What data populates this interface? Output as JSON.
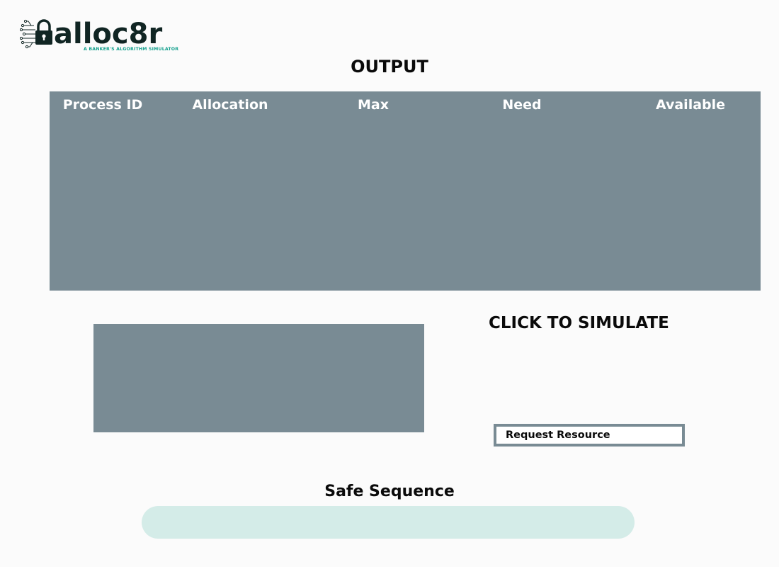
{
  "app": {
    "logo_text": "alloc8r",
    "tagline": "A BANKER'S ALGORITHM SIMULATOR"
  },
  "output": {
    "title": "OUTPUT",
    "columns": [
      "Process ID",
      "Allocation",
      "Max",
      "Need",
      "Available"
    ]
  },
  "simulate": {
    "title": "CLICK TO SIMULATE",
    "request_button_label": "Request Resource"
  },
  "safe_sequence": {
    "title": "Safe Sequence",
    "value": ""
  },
  "colors": {
    "panel": "#798b94",
    "background": "#fbfbfb",
    "logo_dark": "#102523",
    "logo_accent": "#13a08d",
    "safe_bar": "#d4ece8",
    "header_text": "#ffffff"
  },
  "icons": {
    "logo_icon": "padlock-circuit-icon"
  }
}
